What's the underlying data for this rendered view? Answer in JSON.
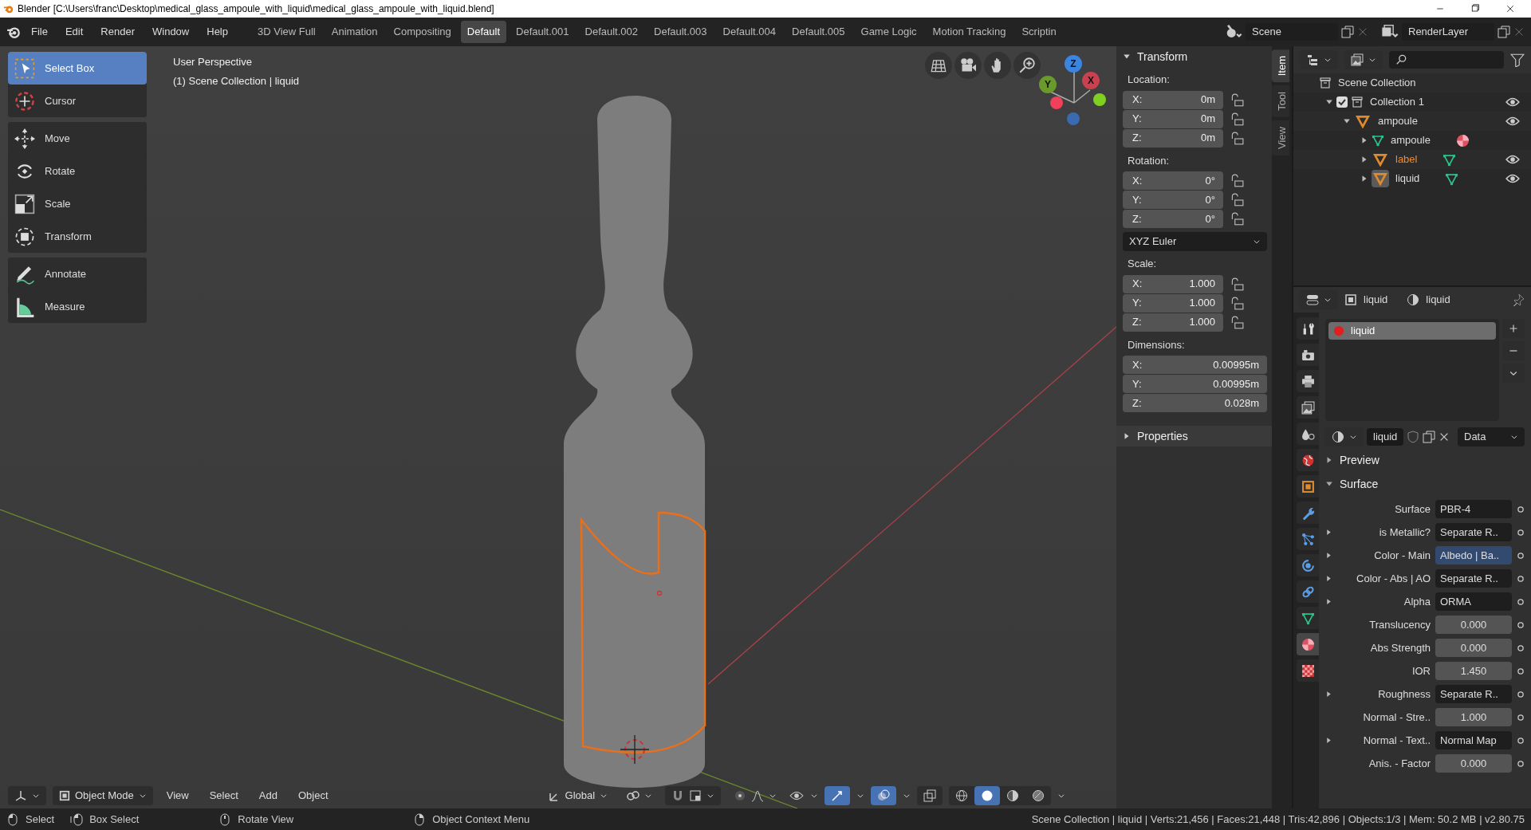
{
  "window": {
    "title": "Blender [C:\\Users\\franc\\Desktop\\medical_glass_ampoule_with_liquid\\medical_glass_ampoule_with_liquid.blend]"
  },
  "menus": [
    "File",
    "Edit",
    "Render",
    "Window",
    "Help"
  ],
  "workspaces": [
    {
      "label": "3D View Full",
      "selected": false
    },
    {
      "label": "Animation",
      "selected": false
    },
    {
      "label": "Compositing",
      "selected": false
    },
    {
      "label": "Default",
      "selected": true
    },
    {
      "label": "Default.001",
      "selected": false
    },
    {
      "label": "Default.002",
      "selected": false
    },
    {
      "label": "Default.003",
      "selected": false
    },
    {
      "label": "Default.004",
      "selected": false
    },
    {
      "label": "Default.005",
      "selected": false
    },
    {
      "label": "Game Logic",
      "selected": false
    },
    {
      "label": "Motion Tracking",
      "selected": false
    },
    {
      "label": "Scriptin",
      "selected": false
    }
  ],
  "scene": {
    "value": "Scene"
  },
  "view_layer": {
    "value": "RenderLayer"
  },
  "tool_groups": [
    {
      "tools": [
        {
          "label": "Select Box",
          "kind": "select-box",
          "selected": true
        },
        {
          "label": "Cursor",
          "kind": "cursor",
          "selected": false
        }
      ]
    },
    {
      "tools": [
        {
          "label": "Move",
          "kind": "move",
          "selected": false
        },
        {
          "label": "Rotate",
          "kind": "rotate",
          "selected": false
        },
        {
          "label": "Scale",
          "kind": "scale",
          "selected": false
        },
        {
          "label": "Transform",
          "kind": "transform",
          "selected": false
        }
      ]
    },
    {
      "tools": [
        {
          "label": "Annotate",
          "kind": "annotate",
          "selected": false
        },
        {
          "label": "Measure",
          "kind": "measure",
          "selected": false
        }
      ]
    }
  ],
  "viewport": {
    "info": [
      "User Perspective",
      "(1) Scene Collection | liquid"
    ],
    "axes": [
      "Z",
      "Y",
      "X"
    ],
    "mode": "Object Mode",
    "menus": [
      "View",
      "Select",
      "Add",
      "Object"
    ],
    "orientation": "Global",
    "shading": [
      {
        "kind": "wireframe",
        "selected": false
      },
      {
        "kind": "solid",
        "selected": true
      },
      {
        "kind": "material",
        "selected": false
      },
      {
        "kind": "rendered",
        "selected": false
      }
    ]
  },
  "sidebar": {
    "tabs": [
      {
        "label": "Item",
        "selected": true
      },
      {
        "label": "Tool",
        "selected": false
      },
      {
        "label": "View",
        "selected": false
      }
    ],
    "transform": {
      "title": "Transform",
      "expanded": true,
      "groups": [
        {
          "label": "Location:",
          "fields": [
            {
              "axis": "X:",
              "value": "0m",
              "locked": false
            },
            {
              "axis": "Y:",
              "value": "0m",
              "locked": false
            },
            {
              "axis": "Z:",
              "value": "0m",
              "locked": false
            }
          ]
        },
        {
          "label": "Rotation:",
          "fields": [
            {
              "axis": "X:",
              "value": "0°",
              "locked": false
            },
            {
              "axis": "Y:",
              "value": "0°",
              "locked": false
            },
            {
              "axis": "Z:",
              "value": "0°",
              "locked": false
            }
          ],
          "mode": "XYZ Euler"
        },
        {
          "label": "Scale:",
          "fields": [
            {
              "axis": "X:",
              "value": "1.000",
              "locked": false
            },
            {
              "axis": "Y:",
              "value": "1.000",
              "locked": false
            },
            {
              "axis": "Z:",
              "value": "1.000",
              "locked": false
            }
          ]
        },
        {
          "label": "Dimensions:",
          "fields": [
            {
              "axis": "X:",
              "value": "0.00995m"
            },
            {
              "axis": "Y:",
              "value": "0.00995m"
            },
            {
              "axis": "Z:",
              "value": "0.028m"
            }
          ]
        }
      ]
    },
    "properties": {
      "title": "Properties",
      "expanded": false
    }
  },
  "outliner": {
    "tree": [
      {
        "label": "Scene Collection",
        "kind": "scene-collection",
        "selected": false,
        "children": [
          {
            "label": "Collection 1",
            "kind": "collection",
            "checked": true,
            "expanded": true,
            "visible": true,
            "selected": false,
            "children": [
              {
                "label": "ampoule",
                "kind": "object",
                "expanded": true,
                "visible": true,
                "selected": false,
                "active": false,
                "children": [
                  {
                    "label": "ampoule",
                    "kind": "mesh",
                    "expanded": false,
                    "selected": false,
                    "extra": {
                      "kind": "material"
                    }
                  },
                  {
                    "label": "label",
                    "kind": "object",
                    "expanded": false,
                    "visible": true,
                    "selected": true,
                    "active": false,
                    "extra": {
                      "kind": "mesh"
                    }
                  },
                  {
                    "label": "liquid",
                    "kind": "object",
                    "expanded": false,
                    "visible": true,
                    "selected": false,
                    "active": true,
                    "extra": {
                      "kind": "mesh"
                    }
                  }
                ]
              }
            ]
          }
        ]
      }
    ]
  },
  "properties": {
    "object": "liquid",
    "material_name": "liquid",
    "tabs": [
      {
        "kind": "tool",
        "selected": false
      },
      {
        "kind": "render",
        "selected": false
      },
      {
        "kind": "output",
        "selected": false
      },
      {
        "kind": "view-layer",
        "selected": false
      },
      {
        "kind": "scene",
        "selected": false
      },
      {
        "kind": "world",
        "selected": false
      },
      {
        "kind": "object",
        "selected": false
      },
      {
        "kind": "modifier",
        "selected": false
      },
      {
        "kind": "particles",
        "selected": false
      },
      {
        "kind": "physics",
        "selected": false
      },
      {
        "kind": "constraint",
        "selected": false
      },
      {
        "kind": "data",
        "selected": false
      },
      {
        "kind": "material",
        "selected": true
      },
      {
        "kind": "texture",
        "selected": false
      }
    ],
    "slots": [
      {
        "name": "liquid",
        "selected": true
      }
    ],
    "material": {
      "name": "liquid",
      "link": "Data"
    },
    "panels": [
      {
        "title": "Preview",
        "expanded": false
      },
      {
        "title": "Surface",
        "expanded": true
      }
    ],
    "surface": {
      "label": "Surface",
      "value": "PBR-4"
    },
    "inputs": [
      {
        "label": "is Metallic?",
        "kind": "link",
        "expandable": true,
        "value": "Separate R..",
        "highlighted": false
      },
      {
        "label": "Color - Main",
        "kind": "link",
        "expandable": true,
        "value": "Albedo | Ba..",
        "highlighted": true
      },
      {
        "label": "Color - Abs | AO",
        "kind": "link",
        "expandable": true,
        "value": "Separate R..",
        "highlighted": false
      },
      {
        "label": "Alpha",
        "kind": "link",
        "expandable": true,
        "value": "ORMA",
        "highlighted": false
      },
      {
        "label": "Translucency",
        "kind": "number",
        "expandable": false,
        "value": "0.000",
        "highlighted": false
      },
      {
        "label": "Abs Strength",
        "kind": "number",
        "expandable": false,
        "value": "0.000",
        "highlighted": false
      },
      {
        "label": "IOR",
        "kind": "number",
        "expandable": false,
        "value": "1.450",
        "highlighted": false
      },
      {
        "label": "Roughness",
        "kind": "link",
        "expandable": true,
        "value": "Separate R..",
        "highlighted": false
      },
      {
        "label": "Normal - Stre..",
        "kind": "number",
        "expandable": false,
        "value": "1.000",
        "highlighted": false
      },
      {
        "label": "Normal - Text..",
        "kind": "link",
        "expandable": true,
        "value": "Normal Map",
        "highlighted": false
      },
      {
        "label": "Anis. - Factor",
        "kind": "number",
        "expandable": false,
        "value": "0.000",
        "highlighted": false
      }
    ]
  },
  "status_bar": {
    "hints": [
      {
        "kind": "left-mouse",
        "label": "Select"
      },
      {
        "kind": "drag",
        "label": "Box Select"
      },
      {
        "kind": "middle-mouse",
        "label": "Rotate View"
      },
      {
        "kind": "right-mouse",
        "label": "Object Context Menu"
      }
    ],
    "stats": "Scene Collection | liquid | Verts:21,456 | Faces:21,448 | Tris:42,896 | Objects:1/3 | Mem: 50.2 MB | v2.80.75"
  }
}
